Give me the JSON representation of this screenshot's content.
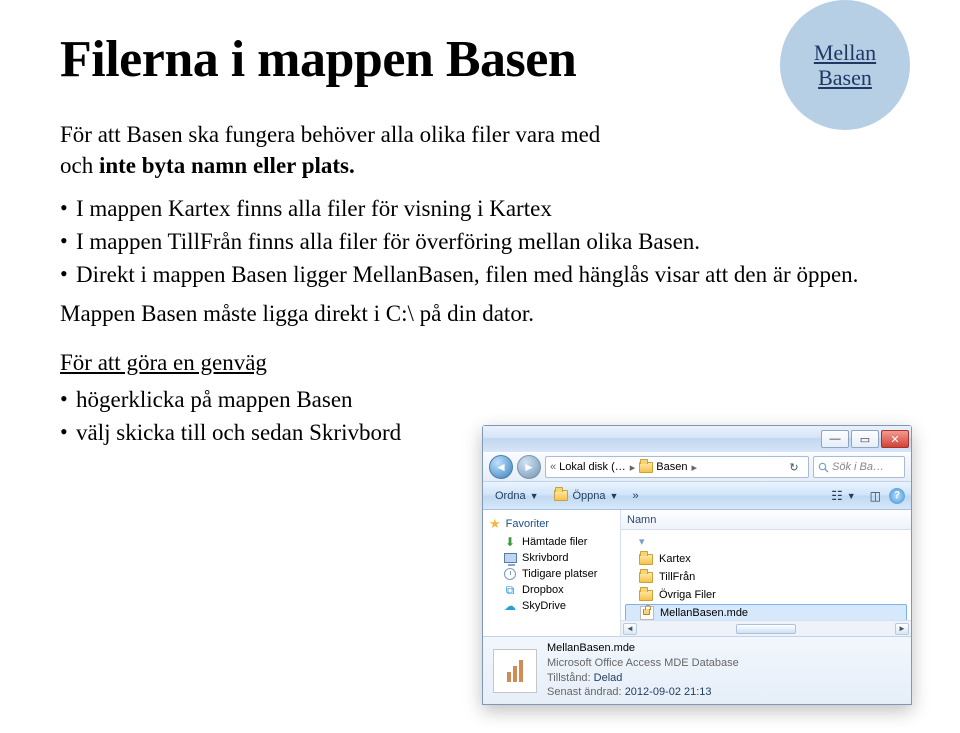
{
  "title": "Filerna i mappen Basen",
  "badge": "Mellan\nBasen",
  "intro_1": "För att Basen ska fungera behöver alla olika filer vara med",
  "intro_2_prefix": "och ",
  "intro_2_bold": "inte byta namn eller plats.",
  "bullets": [
    "I mappen Kartex finns alla filer för visning i Kartex",
    "I mappen TillFrån finns alla filer för överföring mellan olika Basen.",
    "Direkt i mappen Basen ligger MellanBasen, filen med hänglås visar att den är öppen."
  ],
  "note": "Mappen Basen måste ligga direkt i C:\\ på din dator.",
  "sub_heading": "För att göra en genväg",
  "sub_bullets": [
    "högerklicka på mappen Basen",
    "välj skicka till och sedan Skrivbord"
  ],
  "explorer": {
    "breadcrumb": {
      "seg1": "Lokal disk (…",
      "seg2": "Basen"
    },
    "search_placeholder": "Sök i Ba…",
    "toolbar": {
      "organize": "Ordna",
      "open": "Öppna",
      "more": "»"
    },
    "nav": {
      "favorites": "Favoriter",
      "items": [
        "Hämtade filer",
        "Skrivbord",
        "Tidigare platser",
        "Dropbox",
        "SkyDrive"
      ]
    },
    "column": "Namn",
    "rows": [
      "Kartex",
      "TillFrån",
      "Övriga Filer",
      "MellanBasen.mde"
    ],
    "details": {
      "filename": "MellanBasen.mde",
      "filetype": "Microsoft Office Access MDE Database",
      "state_label": "Tillstånd:",
      "state_value": "Delad",
      "modified_label": "Senast ändrad:",
      "modified_value": "2012-09-02 21:13"
    }
  }
}
